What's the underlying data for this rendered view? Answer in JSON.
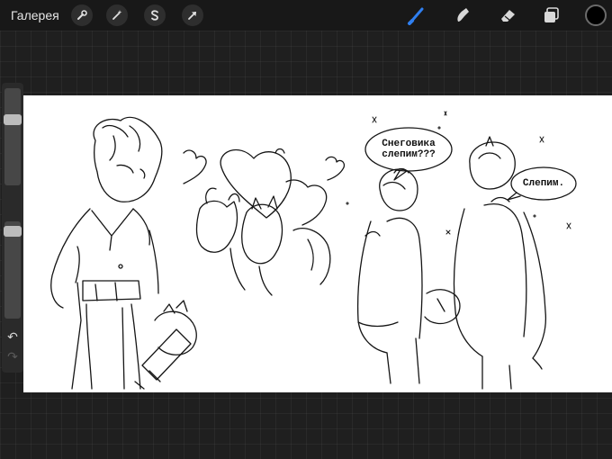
{
  "topbar": {
    "gallery_label": "Галерея",
    "left_tools": [
      {
        "name": "actions",
        "icon": "wrench-icon"
      },
      {
        "name": "adjustments",
        "icon": "magic-wand-icon"
      },
      {
        "name": "selection",
        "icon": "selection-s-icon"
      },
      {
        "name": "transform",
        "icon": "arrow-cursor-icon"
      }
    ],
    "right_tools": [
      {
        "name": "brush",
        "icon": "brush-icon",
        "active": true
      },
      {
        "name": "smudge",
        "icon": "smudge-icon",
        "active": false
      },
      {
        "name": "eraser",
        "icon": "eraser-icon",
        "active": false
      },
      {
        "name": "layers",
        "icon": "layers-icon",
        "active": false
      }
    ],
    "current_color": "#000000",
    "active_tool_color": "#2f7ff0"
  },
  "sidebar": {
    "brush_size_level": 0.3,
    "brush_opacity_level": 0.05,
    "undo_icon": "undo-arrow-icon",
    "redo_icon": "redo-arrow-icon",
    "undo_glyph": "↶",
    "redo_glyph": "↷"
  },
  "canvas": {
    "background": "#ffffff",
    "speech_bubble_1": [
      "Снеговика",
      "слепим???"
    ],
    "speech_bubble_2": "Слепим."
  }
}
